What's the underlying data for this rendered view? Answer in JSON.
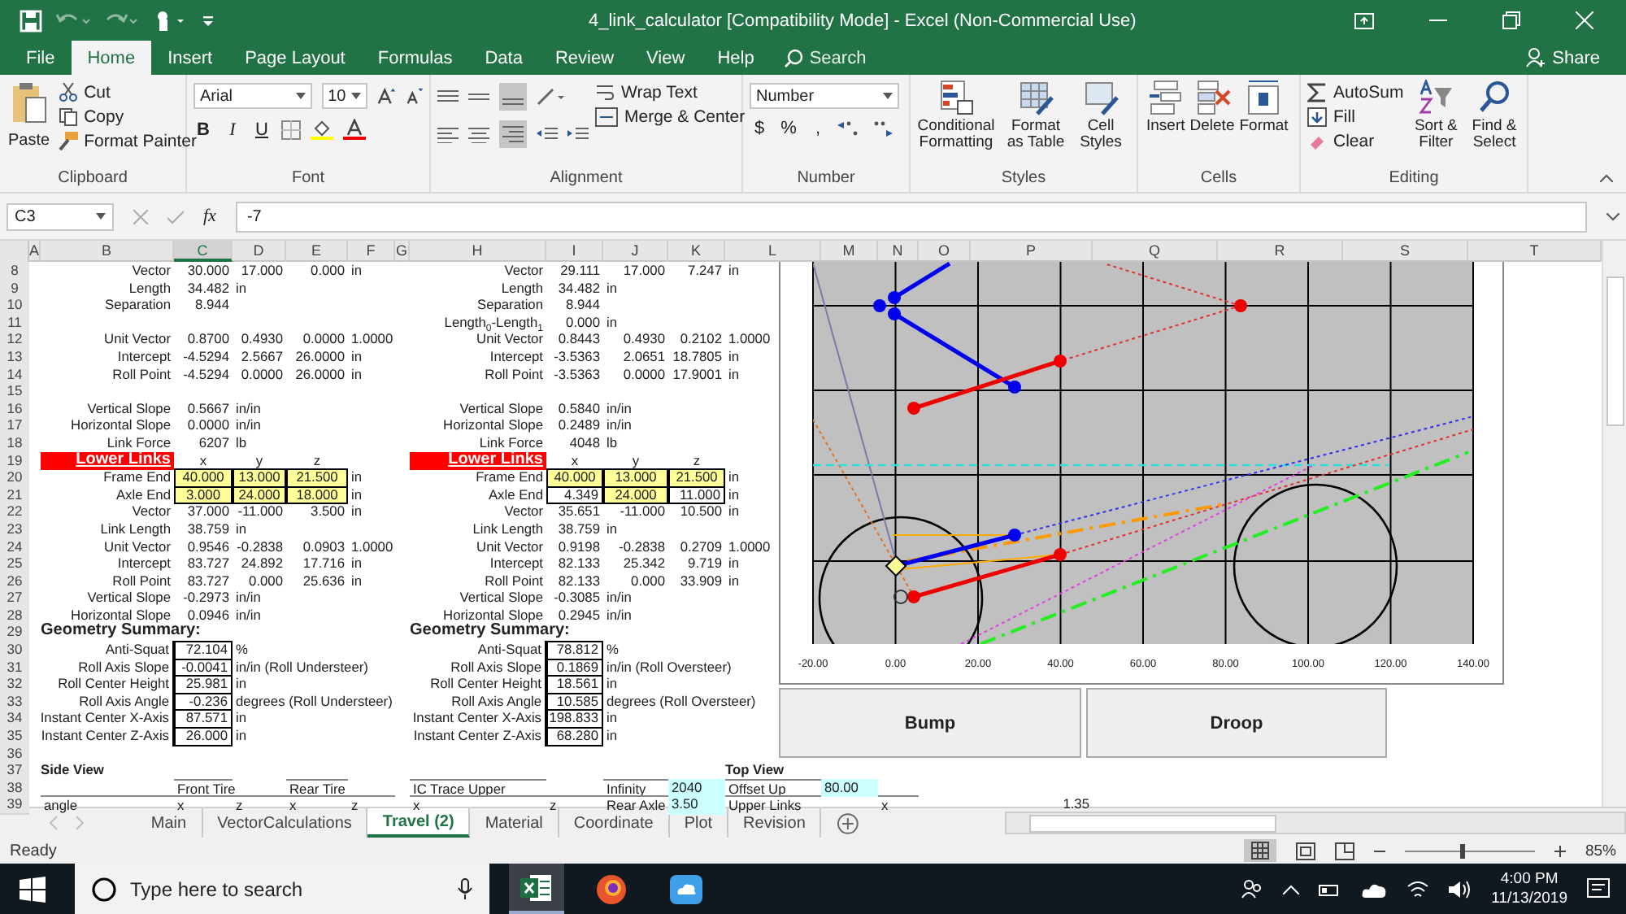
{
  "window": {
    "title": "4_link_calculator  [Compatibility Mode]  -  Excel (Non-Commercial Use)"
  },
  "menu_tabs": [
    {
      "label": "File",
      "selected": false
    },
    {
      "label": "Home",
      "selected": true
    },
    {
      "label": "Insert",
      "selected": false
    },
    {
      "label": "Page Layout",
      "selected": false
    },
    {
      "label": "Formulas",
      "selected": false
    },
    {
      "label": "Data",
      "selected": false
    },
    {
      "label": "Review",
      "selected": false
    },
    {
      "label": "View",
      "selected": false
    },
    {
      "label": "Help",
      "selected": false
    }
  ],
  "search": {
    "placeholder": "Search"
  },
  "share": "Share",
  "ribbon": {
    "clipboard": {
      "title": "Clipboard",
      "paste": "Paste",
      "cut": "Cut",
      "copy": "Copy",
      "format_painter": "Format Painter"
    },
    "font": {
      "title": "Font",
      "family": "Arial",
      "size": "10",
      "bold": "B",
      "italic": "I",
      "underline": "U"
    },
    "alignment": {
      "title": "Alignment",
      "wrap": "Wrap Text",
      "merge": "Merge & Center"
    },
    "number": {
      "title": "Number",
      "format": "Number",
      "currency": "$",
      "percent": "%",
      "comma": ","
    },
    "styles": {
      "title": "Styles",
      "conditional": "Conditional Formatting",
      "table": "Format as Table",
      "cell": "Cell Styles"
    },
    "cells": {
      "title": "Cells",
      "insert": "Insert",
      "delete": "Delete",
      "format": "Format"
    },
    "editing": {
      "title": "Editing",
      "autosum": "AutoSum",
      "fill": "Fill",
      "clear": "Clear",
      "sort": "Sort & Filter",
      "find": "Find & Select"
    }
  },
  "formula_bar": {
    "name_box": "C3",
    "fx": "fx",
    "value": "-7"
  },
  "columns": [
    {
      "label": "A",
      "selected": false
    },
    {
      "label": "B",
      "selected": false
    },
    {
      "label": "C",
      "selected": true
    },
    {
      "label": "D",
      "selected": false
    },
    {
      "label": "E",
      "selected": false
    },
    {
      "label": "F",
      "selected": false
    },
    {
      "label": "G",
      "selected": false
    },
    {
      "label": "H",
      "selected": false
    },
    {
      "label": "I",
      "selected": false
    },
    {
      "label": "J",
      "selected": false
    },
    {
      "label": "K",
      "selected": false
    },
    {
      "label": "L",
      "selected": false
    },
    {
      "label": "M",
      "selected": false
    },
    {
      "label": "N",
      "selected": false
    },
    {
      "label": "O",
      "selected": false
    },
    {
      "label": "P",
      "selected": false
    },
    {
      "label": "Q",
      "selected": false
    },
    {
      "label": "R",
      "selected": false
    },
    {
      "label": "S",
      "selected": false
    },
    {
      "label": "T",
      "selected": false
    }
  ],
  "rows": [
    {
      "num": "8",
      "cells": {
        "B": {
          "kind": "label",
          "text": "Vector"
        },
        "C": {
          "kind": "num",
          "text": "30.000"
        },
        "D": {
          "kind": "num",
          "text": "17.000"
        },
        "E": {
          "kind": "num",
          "text": "0.000"
        },
        "F": {
          "kind": "unit",
          "text": "in"
        },
        "H": {
          "kind": "label",
          "text": "Vector"
        },
        "I": {
          "kind": "num",
          "text": "29.111"
        },
        "J": {
          "kind": "num",
          "text": "17.000"
        },
        "K": {
          "kind": "num",
          "text": "7.247"
        },
        "L": {
          "kind": "unit",
          "text": "in"
        }
      }
    },
    {
      "num": "9",
      "cells": {
        "B": {
          "kind": "label",
          "text": "Length"
        },
        "C": {
          "kind": "num",
          "text": "34.482"
        },
        "D": {
          "kind": "unit",
          "text": "in"
        },
        "H": {
          "kind": "label",
          "text": "Length"
        },
        "I": {
          "kind": "num",
          "text": "34.482"
        },
        "J": {
          "kind": "unit",
          "text": "in"
        }
      }
    },
    {
      "num": "10",
      "cells": {
        "B": {
          "kind": "label",
          "text": "Separation"
        },
        "C": {
          "kind": "num",
          "text": "8.944"
        },
        "H": {
          "kind": "label",
          "text": "Separation"
        },
        "I": {
          "kind": "num",
          "text": "8.944"
        }
      }
    },
    {
      "num": "11",
      "cells": {
        "H": {
          "kind": "label",
          "text": "Length$_{0}$-Length$_{1}$"
        },
        "I": {
          "kind": "num",
          "text": "0.000"
        },
        "J": {
          "kind": "unit",
          "text": "in"
        }
      }
    },
    {
      "num": "12",
      "cells": {
        "B": {
          "kind": "label",
          "text": "Unit Vector"
        },
        "C": {
          "kind": "num",
          "text": "0.8700"
        },
        "D": {
          "kind": "num",
          "text": "0.4930"
        },
        "E": {
          "kind": "num",
          "text": "0.0000"
        },
        "F": {
          "kind": "unit",
          "text": "1.0000"
        },
        "H": {
          "kind": "label",
          "text": "Unit Vector"
        },
        "I": {
          "kind": "num",
          "text": "0.8443"
        },
        "J": {
          "kind": "num",
          "text": "0.4930"
        },
        "K": {
          "kind": "num",
          "text": "0.2102"
        },
        "L": {
          "kind": "unit",
          "text": "1.0000"
        }
      }
    },
    {
      "num": "13",
      "cells": {
        "B": {
          "kind": "label",
          "text": "Intercept"
        },
        "C": {
          "kind": "num",
          "text": "-4.5294"
        },
        "D": {
          "kind": "num",
          "text": "2.5667"
        },
        "E": {
          "kind": "num",
          "text": "26.0000"
        },
        "F": {
          "kind": "unit",
          "text": "in"
        },
        "H": {
          "kind": "label",
          "text": "Intercept"
        },
        "I": {
          "kind": "num",
          "text": "-3.5363"
        },
        "J": {
          "kind": "num",
          "text": "2.0651"
        },
        "K": {
          "kind": "num",
          "text": "18.7805"
        },
        "L": {
          "kind": "unit",
          "text": "in"
        }
      }
    },
    {
      "num": "14",
      "cells": {
        "B": {
          "kind": "label",
          "text": "Roll Point"
        },
        "C": {
          "kind": "num",
          "text": "-4.5294"
        },
        "D": {
          "kind": "num",
          "text": "0.0000"
        },
        "E": {
          "kind": "num",
          "text": "26.0000"
        },
        "F": {
          "kind": "unit",
          "text": "in"
        },
        "H": {
          "kind": "label",
          "text": "Roll Point"
        },
        "I": {
          "kind": "num",
          "text": "-3.5363"
        },
        "J": {
          "kind": "num",
          "text": "0.0000"
        },
        "K": {
          "kind": "num",
          "text": "17.9001"
        },
        "L": {
          "kind": "unit",
          "text": "in"
        }
      }
    },
    {
      "num": "15"
    },
    {
      "num": "16",
      "cells": {
        "B": {
          "kind": "label",
          "text": "Vertical Slope"
        },
        "C": {
          "kind": "num",
          "text": "0.5667"
        },
        "D": {
          "kind": "unit",
          "text": "in/in"
        },
        "H": {
          "kind": "label",
          "text": "Vertical Slope"
        },
        "I": {
          "kind": "num",
          "text": "0.5840"
        },
        "J": {
          "kind": "unit",
          "text": "in/in"
        }
      }
    },
    {
      "num": "17",
      "cells": {
        "B": {
          "kind": "label",
          "text": "Horizontal Slope"
        },
        "C": {
          "kind": "num",
          "text": "0.0000"
        },
        "D": {
          "kind": "unit",
          "text": "in/in"
        },
        "H": {
          "kind": "label",
          "text": "Horizontal Slope"
        },
        "I": {
          "kind": "num",
          "text": "0.2489"
        },
        "J": {
          "kind": "unit",
          "text": "in/in"
        }
      }
    },
    {
      "num": "18",
      "cells": {
        "B": {
          "kind": "label",
          "text": "Link Force"
        },
        "C": {
          "kind": "num",
          "text": "6207"
        },
        "D": {
          "kind": "unit",
          "text": "lb"
        },
        "H": {
          "kind": "label",
          "text": "Link Force"
        },
        "I": {
          "kind": "num",
          "text": "4048"
        },
        "J": {
          "kind": "unit",
          "text": "lb"
        }
      }
    },
    {
      "num": "19",
      "cells": {
        "B": {
          "kind": "banner",
          "text": "Lower Links"
        },
        "C": {
          "kind": "axis",
          "text": "x"
        },
        "D": {
          "kind": "axis",
          "text": "y"
        },
        "E": {
          "kind": "axis",
          "text": "z"
        },
        "H": {
          "kind": "banner",
          "text": "Lower Links"
        },
        "I": {
          "kind": "axis",
          "text": "x"
        },
        "J": {
          "kind": "axis",
          "text": "y"
        },
        "K": {
          "kind": "axis",
          "text": "z"
        }
      }
    },
    {
      "num": "20",
      "cells": {
        "B": {
          "kind": "label",
          "text": "Frame End"
        },
        "C": {
          "kind": "input",
          "text": "40.000"
        },
        "D": {
          "kind": "input",
          "text": "13.000"
        },
        "E": {
          "kind": "input",
          "text": "21.500"
        },
        "F": {
          "kind": "unit",
          "text": "in"
        },
        "H": {
          "kind": "label",
          "text": "Frame End"
        },
        "I": {
          "kind": "input",
          "text": "40.000"
        },
        "J": {
          "kind": "input",
          "text": "13.000"
        },
        "K": {
          "kind": "input",
          "text": "21.500"
        },
        "L": {
          "kind": "unit",
          "text": "in"
        }
      }
    },
    {
      "num": "21",
      "cells": {
        "B": {
          "kind": "label",
          "text": "Axle End"
        },
        "C": {
          "kind": "input",
          "text": "3.000"
        },
        "D": {
          "kind": "input",
          "text": "24.000"
        },
        "E": {
          "kind": "input",
          "text": "18.000"
        },
        "F": {
          "kind": "unit",
          "text": "in"
        },
        "H": {
          "kind": "label",
          "text": "Axle End"
        },
        "I": {
          "kind": "box",
          "text": "4.349"
        },
        "J": {
          "kind": "input",
          "text": "24.000"
        },
        "K": {
          "kind": "box",
          "text": "11.000"
        },
        "L": {
          "kind": "unit",
          "text": "in"
        }
      }
    },
    {
      "num": "22",
      "cells": {
        "B": {
          "kind": "label",
          "text": "Vector"
        },
        "C": {
          "kind": "num",
          "text": "37.000"
        },
        "D": {
          "kind": "num",
          "text": "-11.000"
        },
        "E": {
          "kind": "num",
          "text": "3.500"
        },
        "F": {
          "kind": "unit",
          "text": "in"
        },
        "H": {
          "kind": "label",
          "text": "Vector"
        },
        "I": {
          "kind": "num",
          "text": "35.651"
        },
        "J": {
          "kind": "num",
          "text": "-11.000"
        },
        "K": {
          "kind": "num",
          "text": "10.500"
        },
        "L": {
          "kind": "unit",
          "text": "in"
        }
      }
    },
    {
      "num": "23",
      "cells": {
        "B": {
          "kind": "label",
          "text": "Link Length"
        },
        "C": {
          "kind": "num",
          "text": "38.759"
        },
        "D": {
          "kind": "unit",
          "text": "in"
        },
        "H": {
          "kind": "label",
          "text": "Link Length"
        },
        "I": {
          "kind": "num",
          "text": "38.759"
        },
        "J": {
          "kind": "unit",
          "text": "in"
        }
      }
    },
    {
      "num": "24",
      "cells": {
        "B": {
          "kind": "label",
          "text": "Unit Vector"
        },
        "C": {
          "kind": "num",
          "text": "0.9546"
        },
        "D": {
          "kind": "num",
          "text": "-0.2838"
        },
        "E": {
          "kind": "num",
          "text": "0.0903"
        },
        "F": {
          "kind": "unit",
          "text": "1.0000"
        },
        "H": {
          "kind": "label",
          "text": "Unit Vector"
        },
        "I": {
          "kind": "num",
          "text": "0.9198"
        },
        "J": {
          "kind": "num",
          "text": "-0.2838"
        },
        "K": {
          "kind": "num",
          "text": "0.2709"
        },
        "L": {
          "kind": "unit",
          "text": "1.0000"
        }
      }
    },
    {
      "num": "25",
      "cells": {
        "B": {
          "kind": "label",
          "text": "Intercept"
        },
        "C": {
          "kind": "num",
          "text": "83.727"
        },
        "D": {
          "kind": "num",
          "text": "24.892"
        },
        "E": {
          "kind": "num",
          "text": "17.716"
        },
        "F": {
          "kind": "unit",
          "text": "in"
        },
        "H": {
          "kind": "label",
          "text": "Intercept"
        },
        "I": {
          "kind": "num",
          "text": "82.133"
        },
        "J": {
          "kind": "num",
          "text": "25.342"
        },
        "K": {
          "kind": "num",
          "text": "9.719"
        },
        "L": {
          "kind": "unit",
          "text": "in"
        }
      }
    },
    {
      "num": "26",
      "cells": {
        "B": {
          "kind": "label",
          "text": "Roll Point"
        },
        "C": {
          "kind": "num",
          "text": "83.727"
        },
        "D": {
          "kind": "num",
          "text": "0.000"
        },
        "E": {
          "kind": "num",
          "text": "25.636"
        },
        "F": {
          "kind": "unit",
          "text": "in"
        },
        "H": {
          "kind": "label",
          "text": "Roll Point"
        },
        "I": {
          "kind": "num",
          "text": "82.133"
        },
        "J": {
          "kind": "num",
          "text": "0.000"
        },
        "K": {
          "kind": "num",
          "text": "33.909"
        },
        "L": {
          "kind": "unit",
          "text": "in"
        }
      }
    },
    {
      "num": "27",
      "cells": {
        "B": {
          "kind": "label",
          "text": "Vertical Slope"
        },
        "C": {
          "kind": "num",
          "text": "-0.2973"
        },
        "D": {
          "kind": "unit",
          "text": "in/in"
        },
        "H": {
          "kind": "label",
          "text": "Vertical Slope"
        },
        "I": {
          "kind": "num",
          "text": "-0.3085"
        },
        "J": {
          "kind": "unit",
          "text": "in/in"
        }
      }
    },
    {
      "num": "28",
      "cells": {
        "B": {
          "kind": "label",
          "text": "Horizontal Slope"
        },
        "C": {
          "kind": "num",
          "text": "0.0946"
        },
        "D": {
          "kind": "unit",
          "text": "in/in"
        },
        "H": {
          "kind": "label",
          "text": "Horizontal Slope"
        },
        "I": {
          "kind": "num",
          "text": "0.2945"
        },
        "J": {
          "kind": "unit",
          "text": "in/in"
        }
      }
    },
    {
      "num": "29",
      "cells": {
        "B": {
          "kind": "title",
          "text": "Geometry Summary:"
        },
        "H": {
          "kind": "title",
          "text": "Geometry Summary:"
        }
      }
    },
    {
      "num": "30",
      "cells": {
        "B": {
          "kind": "boxlabel",
          "text": "Anti-Squat"
        },
        "C": {
          "kind": "box",
          "text": "72.104"
        },
        "D": {
          "kind": "unit",
          "text": "%"
        },
        "H": {
          "kind": "boxlabel",
          "text": "Anti-Squat"
        },
        "I": {
          "kind": "box",
          "text": "78.812"
        },
        "J": {
          "kind": "unit",
          "text": "%"
        }
      }
    },
    {
      "num": "31",
      "cells": {
        "B": {
          "kind": "boxlabel",
          "text": "Roll Axis Slope"
        },
        "C": {
          "kind": "box",
          "text": "-0.0041"
        },
        "D": {
          "kind": "unit",
          "text": "in/in (Roll Understeer)"
        },
        "H": {
          "kind": "boxlabel",
          "text": "Roll Axis Slope"
        },
        "I": {
          "kind": "box",
          "text": "0.1869"
        },
        "J": {
          "kind": "unit",
          "text": "in/in (Roll Oversteer)"
        }
      }
    },
    {
      "num": "32",
      "cells": {
        "B": {
          "kind": "boxlabel",
          "text": "Roll Center Height"
        },
        "C": {
          "kind": "box",
          "text": "25.981"
        },
        "D": {
          "kind": "unit",
          "text": "in"
        },
        "H": {
          "kind": "boxlabel",
          "text": "Roll Center Height"
        },
        "I": {
          "kind": "box",
          "text": "18.561"
        },
        "J": {
          "kind": "unit",
          "text": "in"
        }
      }
    },
    {
      "num": "33",
      "cells": {
        "B": {
          "kind": "boxlabel",
          "text": "Roll Axis Angle"
        },
        "C": {
          "kind": "box",
          "text": "-0.236"
        },
        "D": {
          "kind": "unit",
          "text": "degrees (Roll Understeer)"
        },
        "H": {
          "kind": "boxlabel",
          "text": "Roll Axis Angle"
        },
        "I": {
          "kind": "box",
          "text": "10.585"
        },
        "J": {
          "kind": "unit",
          "text": "degrees (Roll Oversteer)"
        }
      }
    },
    {
      "num": "34",
      "cells": {
        "B": {
          "kind": "boxlabel",
          "text": "Instant Center X-Axis"
        },
        "C": {
          "kind": "box",
          "text": "87.571"
        },
        "D": {
          "kind": "unit",
          "text": "in"
        },
        "H": {
          "kind": "boxlabel",
          "text": "Instant Center X-Axis"
        },
        "I": {
          "kind": "box",
          "text": "198.833"
        },
        "J": {
          "kind": "unit",
          "text": "in"
        }
      }
    },
    {
      "num": "35",
      "cells": {
        "B": {
          "kind": "boxlabel",
          "text": "Instant Center Z-Axis"
        },
        "C": {
          "kind": "box",
          "text": "26.000"
        },
        "D": {
          "kind": "unit",
          "text": "in"
        },
        "H": {
          "kind": "boxlabel",
          "text": "Instant Center Z-Axis"
        },
        "I": {
          "kind": "box",
          "text": "68.280"
        },
        "J": {
          "kind": "unit",
          "text": "in"
        }
      }
    },
    {
      "num": "36"
    },
    {
      "num": "37",
      "cells": {
        "B": {
          "kind": "bold",
          "text": "Side View"
        },
        "L": {
          "kind": "bold",
          "text": "Top View"
        }
      }
    },
    {
      "num": "38",
      "cells": {
        "C": {
          "kind": "text",
          "text": "Front Tire"
        },
        "E": {
          "kind": "text",
          "text": "Rear Tire"
        },
        "H": {
          "kind": "text",
          "text": "IC Trace Upper"
        },
        "J": {
          "kind": "text",
          "text": "Infinity"
        },
        "K": {
          "kind": "cyan",
          "text": "2040"
        },
        "L": {
          "kind": "text",
          "text": "Offset Up"
        },
        "M": {
          "kind": "cyan",
          "text": "80.00"
        }
      }
    },
    {
      "num": "39",
      "cells": {
        "B": {
          "kind": "text",
          "text": "angle"
        },
        "C": {
          "kind": "text",
          "text": "x"
        },
        "D": {
          "kind": "text",
          "text": "z"
        },
        "E": {
          "kind": "text",
          "text": "x"
        },
        "F": {
          "kind": "text",
          "text": "z"
        },
        "H": {
          "kind": "text",
          "text": "x"
        },
        "I": {
          "kind": "text",
          "text": "z"
        },
        "J": {
          "kind": "text",
          "text": "Rear Axle"
        },
        "K": {
          "kind": "cyan",
          "text": "3.50"
        },
        "L": {
          "kind": "text",
          "text": "Upper Links"
        },
        "N": {
          "kind": "text",
          "text": "x"
        },
        "P": {
          "kind": "num",
          "text": "1.35"
        }
      }
    }
  ],
  "chart": {
    "x_tick_labels": [
      "-20.00",
      "0.00",
      "20.00",
      "40.00",
      "60.00",
      "80.00",
      "100.00",
      "120.00",
      "140.00"
    ]
  },
  "buttons": [
    "Bump",
    "Droop"
  ],
  "sheet_tabs": [
    {
      "label": "Main",
      "selected": false
    },
    {
      "label": "VectorCalculations",
      "selected": false
    },
    {
      "label": "Travel (2)",
      "selected": true
    },
    {
      "label": "Material",
      "selected": false
    },
    {
      "label": "Coordinate",
      "selected": false
    },
    {
      "label": "Plot",
      "selected": false
    },
    {
      "label": "Revision",
      "selected": false
    }
  ],
  "status_bar": {
    "mode": "Ready",
    "zoom": "85%",
    "zoom_slider": {
      "level": 0.44
    }
  },
  "taskbar": {
    "search_placeholder": "Type here to search",
    "time": "4:00 PM",
    "date": "11/13/2019"
  }
}
